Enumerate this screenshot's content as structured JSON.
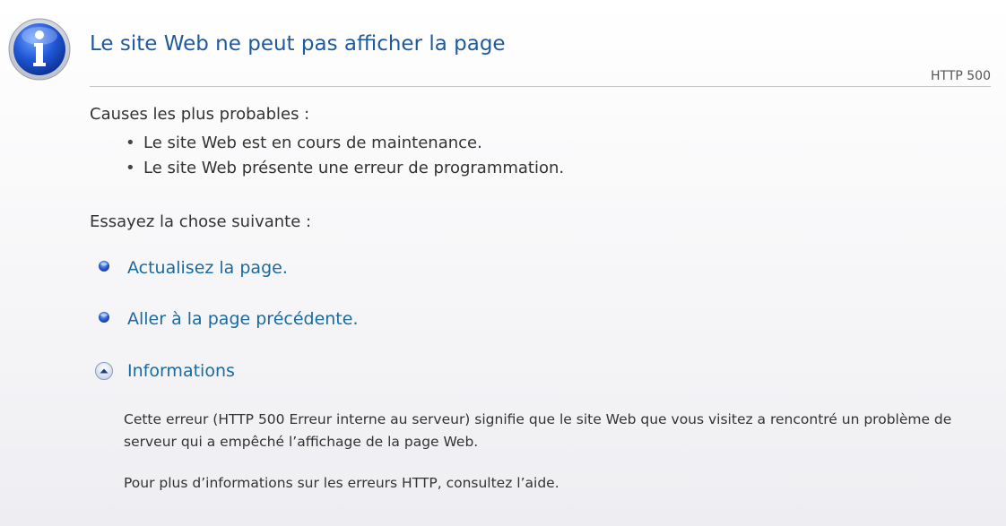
{
  "header": {
    "title": "Le site Web ne peut pas afficher la page",
    "http_code": "HTTP 500",
    "icon": "info-icon"
  },
  "causes": {
    "heading": "Causes les plus probables :",
    "items": [
      "Le site Web est en cours de maintenance.",
      "Le site Web présente une erreur de programmation."
    ]
  },
  "try": {
    "heading": "Essayez la chose suivante :",
    "actions": [
      {
        "label": "Actualisez la page.",
        "icon": "blue-bullet-icon"
      },
      {
        "label": "Aller à la page précédente.",
        "icon": "blue-bullet-icon"
      },
      {
        "label": "Informations",
        "icon": "collapse-arrow-icon"
      }
    ]
  },
  "info": {
    "paragraph1": "Cette erreur (HTTP 500 Erreur interne au serveur) signifie que le site Web que vous visitez a rencontré un problème de serveur qui a empêché l’affichage de la page Web.",
    "paragraph2": "Pour plus d’informations sur les erreurs HTTP, consultez l’aide."
  },
  "colors": {
    "title": "#1f5a9c",
    "link": "#1a6aa0",
    "text": "#333333",
    "divider": "#c4c4c4"
  }
}
